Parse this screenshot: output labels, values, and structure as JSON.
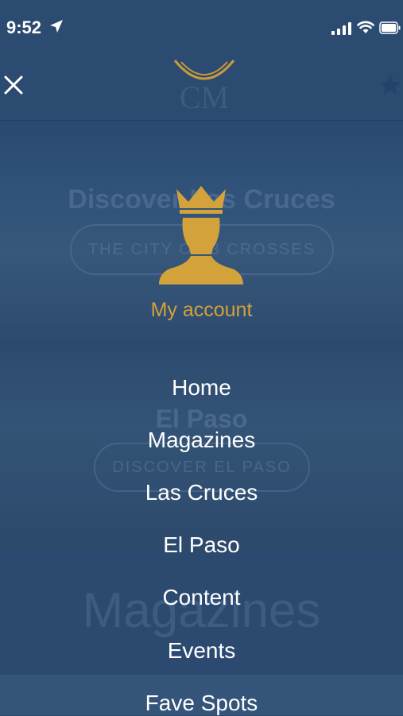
{
  "status_bar": {
    "time": "9:52"
  },
  "background": {
    "hero1_title": "Discover Las Cruces",
    "hero1_button": "THE CITY OF 3 CROSSES",
    "hero2_title": "El Paso",
    "hero2_button": "DISCOVER EL PASO",
    "section_title": "Magazines"
  },
  "account": {
    "label": "My account"
  },
  "menu": {
    "items": [
      {
        "label": "Home"
      },
      {
        "label": "Magazines"
      },
      {
        "label": "Las Cruces"
      },
      {
        "label": "El Paso"
      },
      {
        "label": "Content"
      },
      {
        "label": "Events"
      },
      {
        "label": "Fave Spots"
      }
    ]
  },
  "colors": {
    "accent": "#d4a23a",
    "background": "#2c4d72",
    "menu_text": "#ffffff"
  },
  "icons": [
    "location-arrow-icon",
    "signal-icon",
    "wifi-icon",
    "battery-icon",
    "close-icon",
    "logo",
    "star-icon",
    "crowned-avatar-icon"
  ]
}
